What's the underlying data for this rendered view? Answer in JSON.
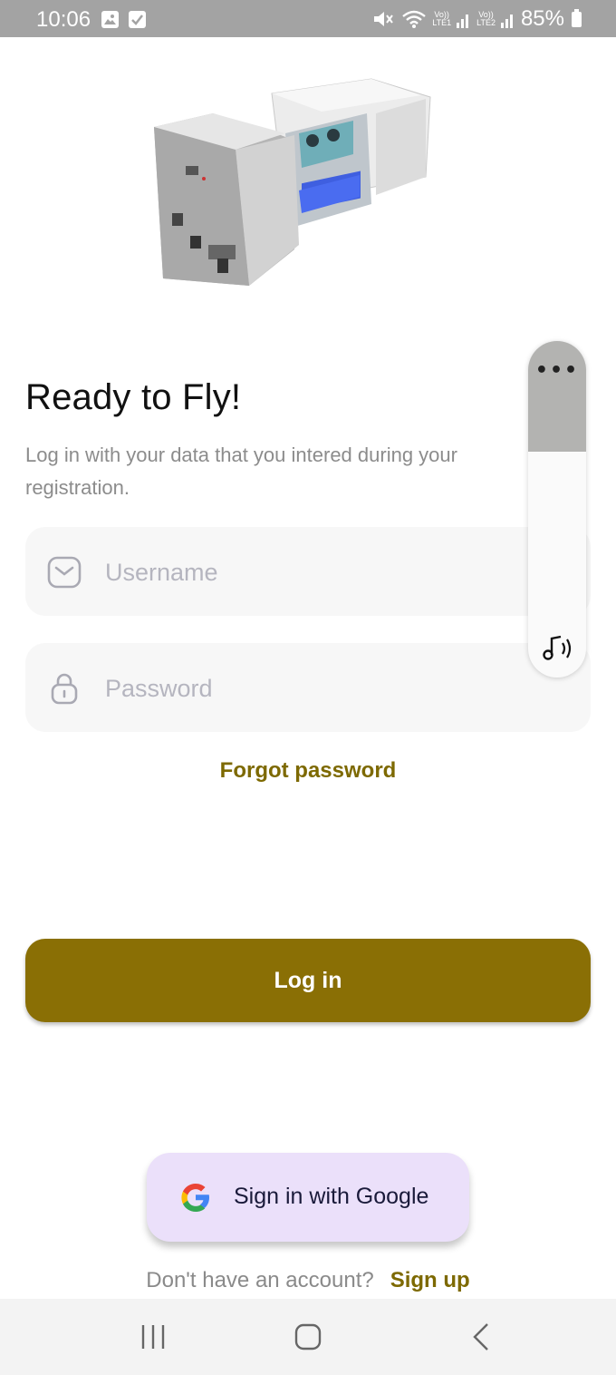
{
  "status_bar": {
    "time": "10:06",
    "lte1": "Vo))\nLTE1",
    "lte2": "Vo))\nLTE2",
    "battery": "85%",
    "icons": [
      "gallery-icon",
      "check-icon",
      "mute-icon",
      "wifi-icon",
      "signal-icon",
      "battery-icon"
    ]
  },
  "hero": {
    "image": "device-machine-illustration"
  },
  "login": {
    "title": "Ready to Fly!",
    "subtitle": "Log in with your data that you intered during your registration.",
    "username_placeholder": "Username",
    "password_placeholder": "Password",
    "forgot": "Forgot password",
    "login_button": "Log in",
    "google_button": "Sign in with Google",
    "no_account": "Don't have an account?",
    "signup": "Sign up"
  },
  "volume_panel": {
    "more_label": "•••",
    "level_fraction": 0.33,
    "icon": "media-volume-icon"
  },
  "colors": {
    "accent": "#8a6f05",
    "link": "#7d6900",
    "google_button_bg": "#ebe0fa",
    "field_bg": "#f7f7f7",
    "status_bar_bg": "#a3a3a3"
  },
  "navigation": [
    "recents-icon",
    "home-icon",
    "back-icon"
  ]
}
